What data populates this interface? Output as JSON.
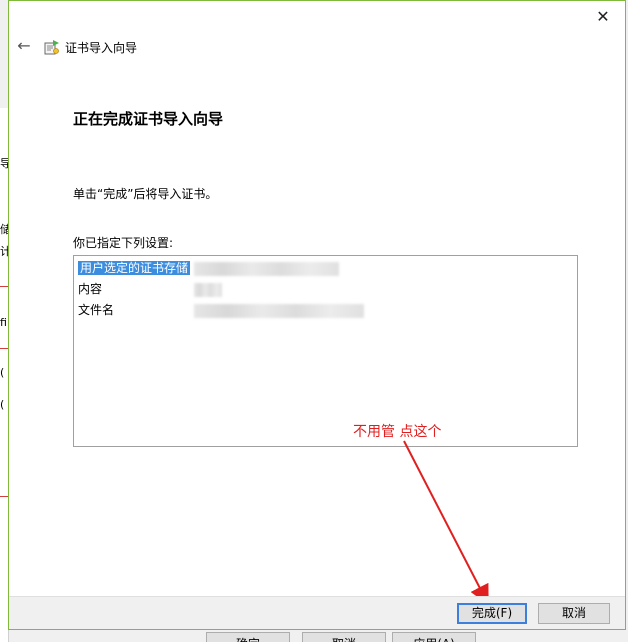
{
  "window": {
    "title": "证书导入向导",
    "close_glyph": "✕",
    "back_glyph": "←"
  },
  "content": {
    "heading": "正在完成证书导入向导",
    "description": "单击“完成”后将导入证书。",
    "list_label": "你已指定下列设置:",
    "settings": [
      {
        "label": "用户选定的证书存储"
      },
      {
        "label": "内容"
      },
      {
        "label": "文件名"
      }
    ]
  },
  "annotation": {
    "text": "不用管 点这个",
    "color": "#e02020"
  },
  "buttons": {
    "finish": "完成(F)",
    "cancel": "取消"
  },
  "background_window": {
    "buttons": [
      "确定",
      "取消",
      "应用(A)"
    ]
  },
  "colors": {
    "selection": "#3c8dde",
    "primary_button_border": "#3c7fdc",
    "dialog_border": "#7fba3b"
  },
  "icons": {
    "back": "back-arrow-icon",
    "wizard": "certificate-icon",
    "close": "close-icon"
  }
}
